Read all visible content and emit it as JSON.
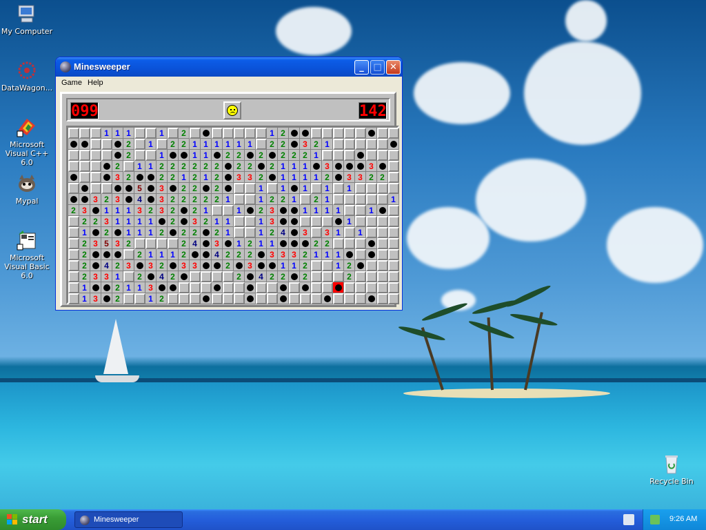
{
  "desktop": {
    "icons": [
      {
        "label": "My Computer",
        "icon": "my-computer-icon"
      },
      {
        "label": "DataWagon...",
        "icon": "datawagon-icon"
      },
      {
        "label": "Microsoft Visual C++ 6.0",
        "icon": "visual-cpp-icon"
      },
      {
        "label": "Mypal",
        "icon": "mypal-icon"
      },
      {
        "label": "Microsoft Visual Basic 6.0",
        "icon": "visual-basic-icon"
      },
      {
        "label": "Recycle Bin",
        "icon": "recycle-bin-icon"
      }
    ]
  },
  "window": {
    "title": "Minesweeper",
    "menus": [
      "Game",
      "Help"
    ],
    "mines_remaining": "099",
    "timer": "142",
    "face_state": "dead",
    "board": [
      "   111  1 2 *     12**     * ",
      "**  *2 1 22111111 22*321     **",
      "    *2  1**11*22*2*2221   *  ",
      "   *2 11222222*22*2111*3***3*   *",
      "*  *32**221212*332*11112*3322 122*",
      " *  **5*3*22*2*  1 1*1 1 1    1",
      "**323*4*3222221  1221 21     1",
      "23*1113232*21  1*23**1111  1*",
      " 2231111*2*3211  13**   *1  ",
      " 1*2*1112*22*21  124*3 31 1",
      " 23532    24*3*1211***22   * ",
      " 2*** 21112**4222*3332111* *  2",
      " 2*423*32*33**2*3**112  12*  ",
      " 2331 2*42*    2*422*2   2    ",
      " 1**2113**   *  *  * *  X     ",
      " 13*2  12   *   *  *   *   * "
    ]
  },
  "taskbar": {
    "start_label": "start",
    "task_label": "Minesweeper",
    "clock": "9:26 AM"
  },
  "colors": {
    "titlebar": "#0a52d8",
    "taskbar": "#245edb",
    "start_button": "#3a9e36",
    "led_text": "#ff0000",
    "board_gray": "#c0c0c0"
  }
}
